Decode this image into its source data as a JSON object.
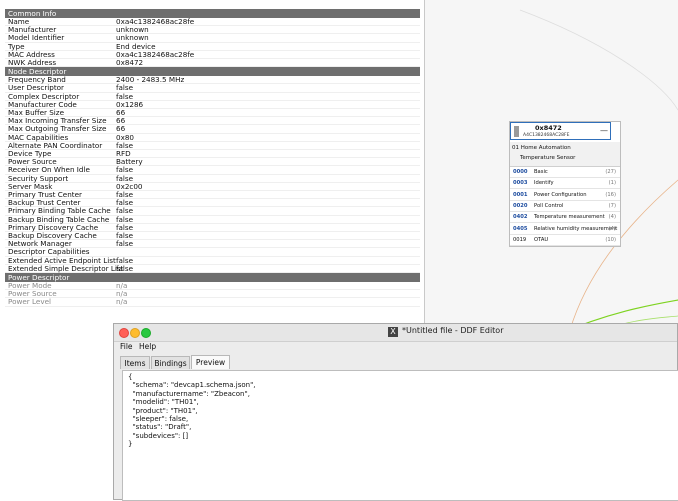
{
  "common_info": {
    "title": "Common Info",
    "rows": [
      {
        "key": "Name",
        "value": "0xa4c1382468ac28fe"
      },
      {
        "key": "Manufacturer",
        "value": "unknown"
      },
      {
        "key": "Model Identifier",
        "value": "unknown"
      },
      {
        "key": "Type",
        "value": "End device"
      },
      {
        "key": "MAC Address",
        "value": "0xa4c1382468ac28fe"
      },
      {
        "key": "NWK Address",
        "value": "0x8472"
      }
    ]
  },
  "node_descriptor": {
    "title": "Node Descriptor",
    "rows": [
      {
        "key": "Frequency Band",
        "value": "2400 - 2483.5 MHz"
      },
      {
        "key": "User Descriptor",
        "value": "false"
      },
      {
        "key": "Complex Descriptor",
        "value": "false"
      },
      {
        "key": "Manufacturer Code",
        "value": "0x1286"
      },
      {
        "key": "Max Buffer Size",
        "value": "66"
      },
      {
        "key": "Max Incoming Transfer Size",
        "value": "66"
      },
      {
        "key": "Max Outgoing Transfer Size",
        "value": "66"
      },
      {
        "key": "MAC Capabilities",
        "value": "0x80"
      },
      {
        "key": "Alternate PAN Coordinator",
        "value": "false"
      },
      {
        "key": "Device Type",
        "value": "RFD"
      },
      {
        "key": "Power Source",
        "value": "Battery"
      },
      {
        "key": "Receiver On When Idle",
        "value": "false"
      },
      {
        "key": "Security Support",
        "value": "false"
      },
      {
        "key": "Server Mask",
        "value": "0x2c00"
      },
      {
        "key": "Primary Trust Center",
        "value": "false"
      },
      {
        "key": "Backup Trust Center",
        "value": "false"
      },
      {
        "key": "Primary Binding Table Cache",
        "value": "false"
      },
      {
        "key": "Backup Binding Table Cache",
        "value": "false"
      },
      {
        "key": "Primary Discovery Cache",
        "value": "false"
      },
      {
        "key": "Backup Discovery Cache",
        "value": "false"
      },
      {
        "key": "Network Manager",
        "value": "false"
      },
      {
        "key": "Descriptor Capabilities",
        "value": ""
      },
      {
        "key": "Extended Active Endpoint List",
        "value": "false"
      },
      {
        "key": "Extended Simple Descriptor List",
        "value": "false"
      }
    ]
  },
  "power_descriptor": {
    "title": "Power Descriptor",
    "rows": [
      {
        "key": "Power Mode",
        "value": "n/a"
      },
      {
        "key": "Power Source",
        "value": "n/a"
      },
      {
        "key": "Power Level",
        "value": "n/a"
      }
    ]
  },
  "node_card": {
    "nwk_address": "0x8472",
    "mac_address": "A4C1382468AC28FE",
    "collapse_symbol": "—",
    "endpoint_id": "01",
    "endpoint_profile": "Home Automation",
    "endpoint_device": "Temperature Sensor",
    "clusters": [
      {
        "id": "0000",
        "name": "Basic",
        "count": "(27)"
      },
      {
        "id": "0003",
        "name": "Identify",
        "count": "(1)"
      },
      {
        "id": "0001",
        "name": "Power Configuration",
        "count": "(16)"
      },
      {
        "id": "0020",
        "name": "Poll Control",
        "count": "(7)"
      },
      {
        "id": "0402",
        "name": "Temperature measurement",
        "count": "(4)"
      },
      {
        "id": "0405",
        "name": "Relative humidity measurement",
        "count": "(4)"
      },
      {
        "id": "0019",
        "name": "OTAU",
        "count": "(10)"
      }
    ]
  },
  "ddf_editor": {
    "title": "*Untitled file - DDF Editor",
    "app_icon_glyph": "X",
    "menu": [
      "File",
      "Help"
    ],
    "tabs": [
      "Items",
      "Bindings",
      "Preview"
    ],
    "active_tab": "Preview",
    "json_lines": [
      "{",
      "  \"schema\": \"devcap1.schema.json\",",
      "  \"manufacturername\": \"Zbeacon\",",
      "  \"modelid\": \"TH01\",",
      "  \"product\": \"TH01\",",
      "  \"sleeper\": false,",
      "  \"status\": \"Draft\",",
      "  \"subdevices\": []",
      "}"
    ]
  },
  "colors": {
    "section_header": "#6e6e6e",
    "cluster_id": "#1f4ea0",
    "node_border": "#2f6fba",
    "link_green": "#7ed321",
    "link_orange": "#e8b48a"
  }
}
